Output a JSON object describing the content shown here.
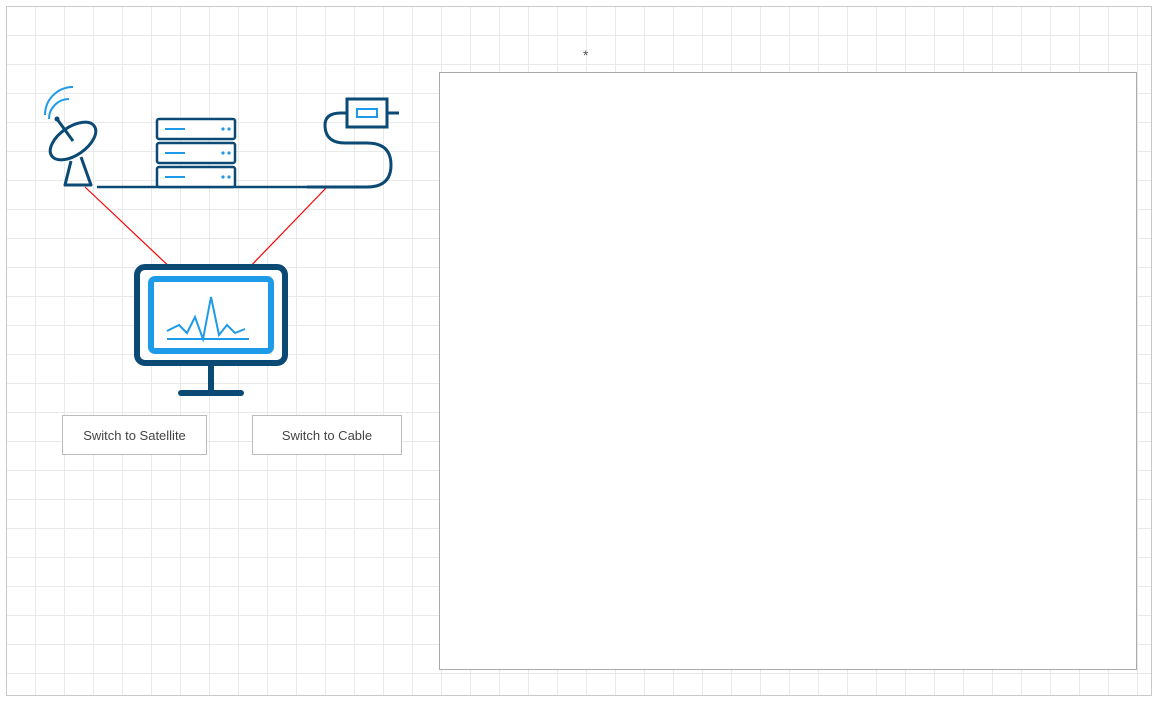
{
  "diagram": {
    "asterisk": "*",
    "nodes": {
      "satellite": {
        "label": "Satellite dish"
      },
      "servers": {
        "label": "Server rack"
      },
      "cable": {
        "label": "Cable modem"
      },
      "tv": {
        "label": "Television / monitor"
      }
    },
    "connections": [
      {
        "from": "satellite",
        "to": "tv",
        "color": "#ff0000"
      },
      {
        "from": "cable",
        "to": "tv",
        "color": "#ff0000"
      },
      {
        "from": "satellite",
        "to": "servers",
        "color": "#0b4a75"
      },
      {
        "from": "servers",
        "to": "cable",
        "color": "#0b4a75"
      }
    ],
    "buttons": {
      "switch_satellite": "Switch to Satellite",
      "switch_cable": "Switch to Cable"
    },
    "colors": {
      "primary_dark": "#0b4a75",
      "accent_blue": "#1e9be8",
      "signal_red": "#ff0000"
    }
  }
}
